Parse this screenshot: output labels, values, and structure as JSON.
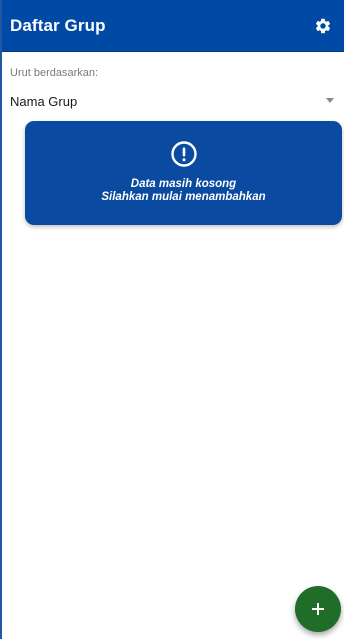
{
  "appbar": {
    "title": "Daftar Grup",
    "settings_icon": "gear-icon",
    "background": "#004aa5"
  },
  "sort": {
    "label": "Urut berdasarkan:",
    "selected": "Nama Grup"
  },
  "empty_state": {
    "icon": "exclamation-circle-icon",
    "line1": "Data masih kosong",
    "line2": "Silahkan mulai menambahkan",
    "background": "#0a4aa0"
  },
  "fab": {
    "icon": "plus-icon",
    "color": "#1f6d29"
  }
}
